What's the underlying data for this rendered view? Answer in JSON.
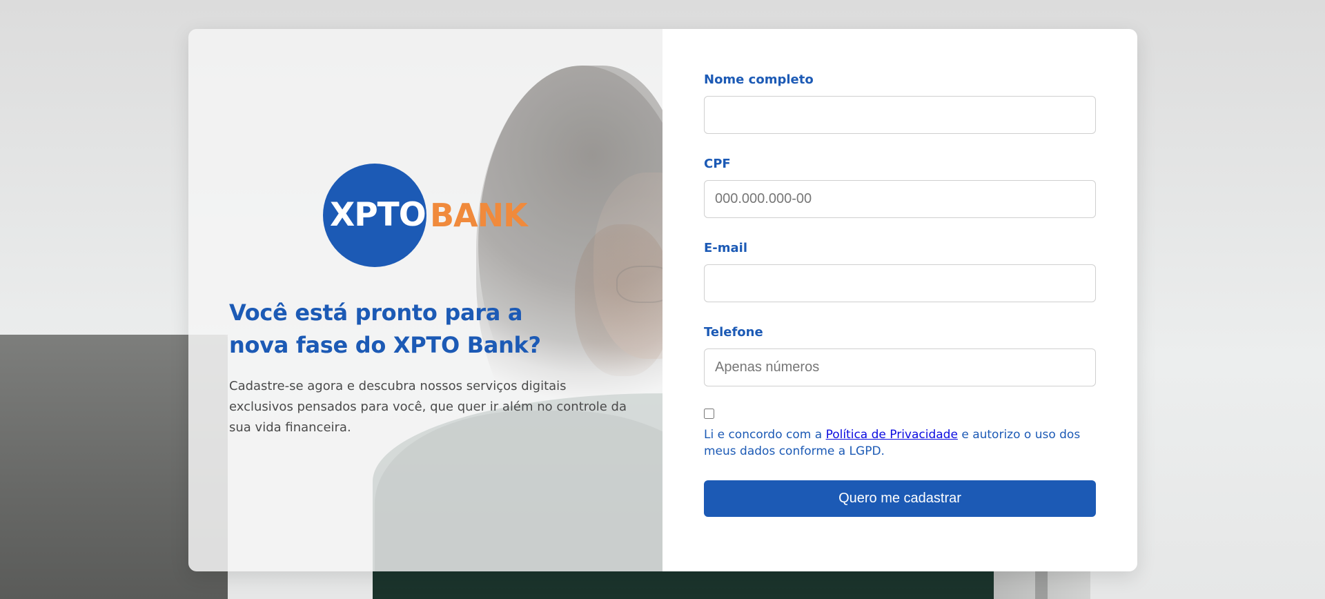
{
  "brand": {
    "logo_text_primary": "XPTO",
    "logo_text_secondary": "BANK",
    "primary_color": "#1c5ab5",
    "accent_color": "#f08a3c"
  },
  "hero": {
    "headline": "Você está pronto para a nova fase do XPTO Bank?",
    "description": "Cadastre-se agora e descubra nossos serviços digitais exclusivos pensados para você, que quer ir além no controle da sua vida financeira."
  },
  "form": {
    "fields": [
      {
        "label": "Nome completo",
        "value": "",
        "placeholder": ""
      },
      {
        "label": "CPF",
        "value": "",
        "placeholder": "000.000.000-00"
      },
      {
        "label": "E-mail",
        "value": "",
        "placeholder": ""
      },
      {
        "label": "Telefone",
        "value": "",
        "placeholder": "Apenas números"
      }
    ],
    "consent": {
      "checked": false,
      "text_before": "Li e concordo com a ",
      "link_text": "Política de Privacidade",
      "text_after": " e autorizo o uso dos meus dados conforme a LGPD."
    },
    "submit_label": "Quero me cadastrar"
  }
}
